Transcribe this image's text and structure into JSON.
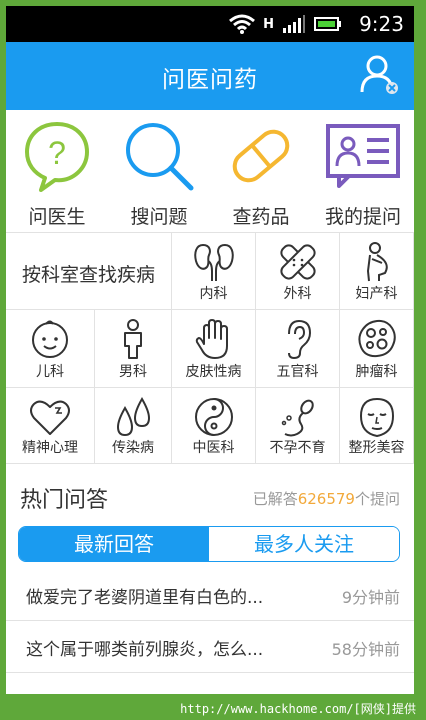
{
  "status": {
    "time": "9:23",
    "network": "H"
  },
  "appbar": {
    "title": "问医问药"
  },
  "quick": [
    {
      "label": "问医生",
      "icon": "chat-question-icon",
      "color": "#8cc63e"
    },
    {
      "label": "搜问题",
      "icon": "search-icon",
      "color": "#1a9bf0"
    },
    {
      "label": "查药品",
      "icon": "pill-icon",
      "color": "#f5b731"
    },
    {
      "label": "我的提问",
      "icon": "profile-card-icon",
      "color": "#7a5bbd"
    }
  ],
  "departments": {
    "title": "按科室查找疾病",
    "items": [
      {
        "label": "内科",
        "icon": "kidney-icon"
      },
      {
        "label": "外科",
        "icon": "bandage-icon"
      },
      {
        "label": "妇产科",
        "icon": "pregnant-woman-icon"
      },
      {
        "label": "儿科",
        "icon": "baby-face-icon"
      },
      {
        "label": "男科",
        "icon": "male-figure-icon"
      },
      {
        "label": "皮肤性病",
        "icon": "hand-icon"
      },
      {
        "label": "五官科",
        "icon": "ear-icon"
      },
      {
        "label": "肿瘤科",
        "icon": "tumor-cell-icon"
      },
      {
        "label": "精神心理",
        "icon": "heart-icon"
      },
      {
        "label": "传染病",
        "icon": "droplets-icon"
      },
      {
        "label": "中医科",
        "icon": "yin-yang-icon"
      },
      {
        "label": "不孕不育",
        "icon": "sperm-icon"
      },
      {
        "label": "整形美容",
        "icon": "face-mask-icon"
      }
    ]
  },
  "hot": {
    "title": "热门问答",
    "stat_prefix": "已解答",
    "stat_count": "626579",
    "stat_suffix": "个提问"
  },
  "tabs": {
    "latest": "最新回答",
    "popular": "最多人关注"
  },
  "questions": [
    {
      "text": "做爱完了老婆阴道里有白色的...",
      "time": "9分钟前"
    },
    {
      "text": "这个属于哪类前列腺炎，怎么...",
      "time": "58分钟前"
    }
  ],
  "watermark": "http://www.hackhome.com/[网侠]提供"
}
